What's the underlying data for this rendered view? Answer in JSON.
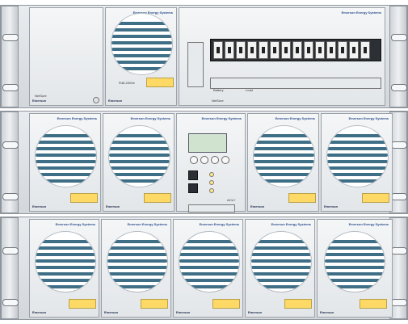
{
  "rack": {
    "brand_text": "Emerson Energy Systems",
    "model_text": "NetSure",
    "label_left": "Emerson",
    "rectifier_label": "R48-2000e",
    "control_label": "ACU+",
    "distribution_labels": [
      "Battery",
      "Load"
    ]
  },
  "colors": {
    "fan_stripes": "#3f6f86",
    "sticker": "#ffd966",
    "panel": "#e3e6e9",
    "frame": "#d3d7db"
  },
  "icons": [
    "rack-ear-slot-icon",
    "fan-grille-icon",
    "breaker-icon",
    "lcd-screen-icon",
    "button-icon",
    "led-icon",
    "port-icon"
  ]
}
